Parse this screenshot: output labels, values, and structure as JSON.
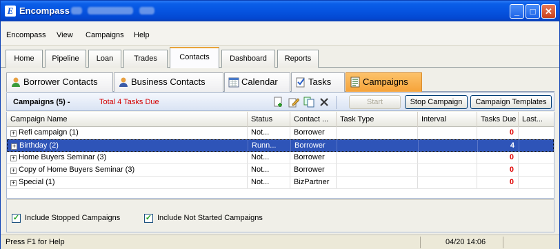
{
  "window": {
    "title": "Encompass",
    "colors": {
      "titlebar": "#0654e0",
      "accent_tab": "#f6a33a",
      "selected_row": "#2e54b8",
      "due_red": "#e00000"
    }
  },
  "menu": {
    "items": [
      "Encompass",
      "View",
      "Campaigns",
      "Help"
    ]
  },
  "main_tabs": [
    "Home",
    "Pipeline",
    "Loan",
    "Trades",
    "Contacts",
    "Dashboard",
    "Reports"
  ],
  "main_tabs_active": "Contacts",
  "sub_tabs": [
    {
      "label": "Borrower Contacts",
      "icon": "person-icon"
    },
    {
      "label": "Business Contacts",
      "icon": "person-icon"
    },
    {
      "label": "Calendar",
      "icon": "calendar-icon"
    },
    {
      "label": "Tasks",
      "icon": "task-check-icon"
    },
    {
      "label": "Campaigns",
      "icon": "campaign-icon"
    }
  ],
  "sub_tabs_active": "Campaigns",
  "panel": {
    "title": "Campaigns (5) -",
    "tasks_due": "Total 4 Tasks Due",
    "start_button": "Start",
    "stop_button": "Stop Campaign",
    "templates_button": "Campaign Templates",
    "toolbar_icons": [
      "new-campaign-icon",
      "edit-icon",
      "duplicate-icon",
      "delete-icon"
    ]
  },
  "grid": {
    "columns": [
      "Campaign Name",
      "Status",
      "Contact ...",
      "Task Type",
      "Interval",
      "Tasks Due",
      "Last..."
    ],
    "rows": [
      {
        "name": "Refi campaign (1)",
        "status": "Not...",
        "contact": "Borrower",
        "task_type": "",
        "interval": "",
        "tasks_due": "0",
        "last": "",
        "selected": false
      },
      {
        "name": "Birthday (2)",
        "status": "Runn...",
        "contact": "Borrower",
        "task_type": "",
        "interval": "",
        "tasks_due": "4",
        "last": "",
        "selected": true
      },
      {
        "name": "Home Buyers Seminar (3)",
        "status": "Not...",
        "contact": "Borrower",
        "task_type": "",
        "interval": "",
        "tasks_due": "0",
        "last": "",
        "selected": false
      },
      {
        "name": "Copy of Home Buyers Seminar (3)",
        "status": "Not...",
        "contact": "Borrower",
        "task_type": "",
        "interval": "",
        "tasks_due": "0",
        "last": "",
        "selected": false
      },
      {
        "name": "Special (1)",
        "status": "Not...",
        "contact": "BizPartner",
        "task_type": "",
        "interval": "",
        "tasks_due": "0",
        "last": "",
        "selected": false
      }
    ]
  },
  "filters": {
    "include_stopped": {
      "label": "Include Stopped Campaigns",
      "checked": true
    },
    "include_not_started": {
      "label": "Include Not Started Campaigns",
      "checked": true
    }
  },
  "status_bar": {
    "help": "Press F1 for Help",
    "datetime": "04/20 14:06"
  }
}
